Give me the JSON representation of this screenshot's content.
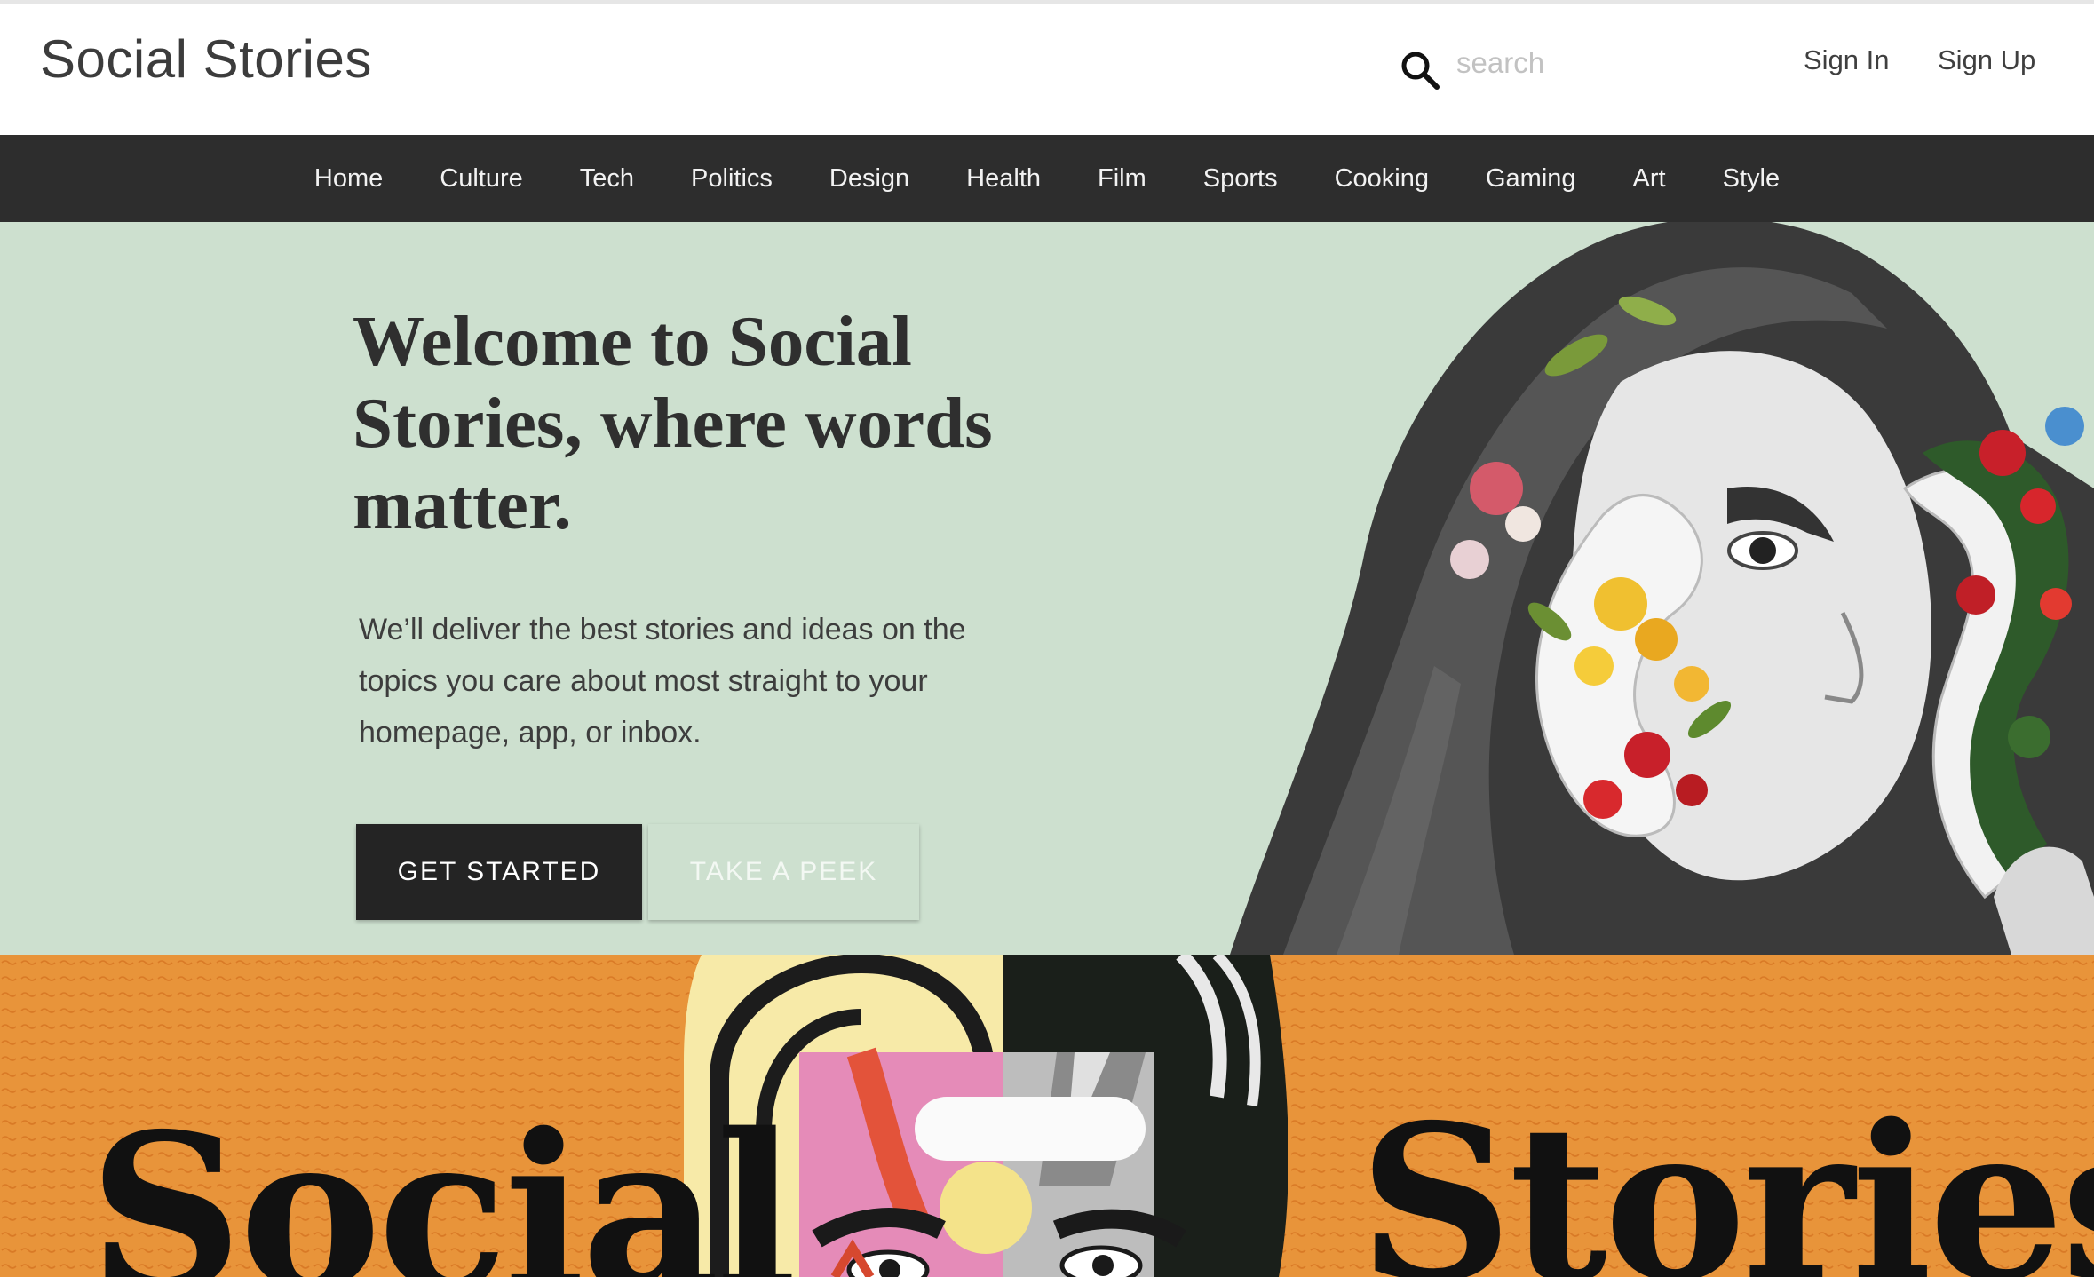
{
  "header": {
    "brand": "Social Stories",
    "search_placeholder": "search",
    "sign_in": "Sign In",
    "sign_up": "Sign Up"
  },
  "nav": {
    "items": [
      "Home",
      "Culture",
      "Tech",
      "Politics",
      "Design",
      "Health",
      "Film",
      "Sports",
      "Cooking",
      "Gaming",
      "Art",
      "Style"
    ]
  },
  "hero": {
    "title": "Welcome to Social Stories, where words matter.",
    "subtitle": "We’ll deliver the best stories and ideas on the topics you care about most straight to your homepage, app, or inbox.",
    "primary_button": "GET STARTED",
    "secondary_button": "TAKE A PEEK",
    "image": "collage-woman-with-flowers"
  },
  "banner": {
    "word_left": "Social",
    "word_right": "Stories",
    "image": "abstract-face-illustration"
  },
  "colors": {
    "nav_bg": "#2d2d2d",
    "hero_bg": "#cde0cf",
    "banner_bg": "#e8943a",
    "primary_button": "#242424"
  }
}
